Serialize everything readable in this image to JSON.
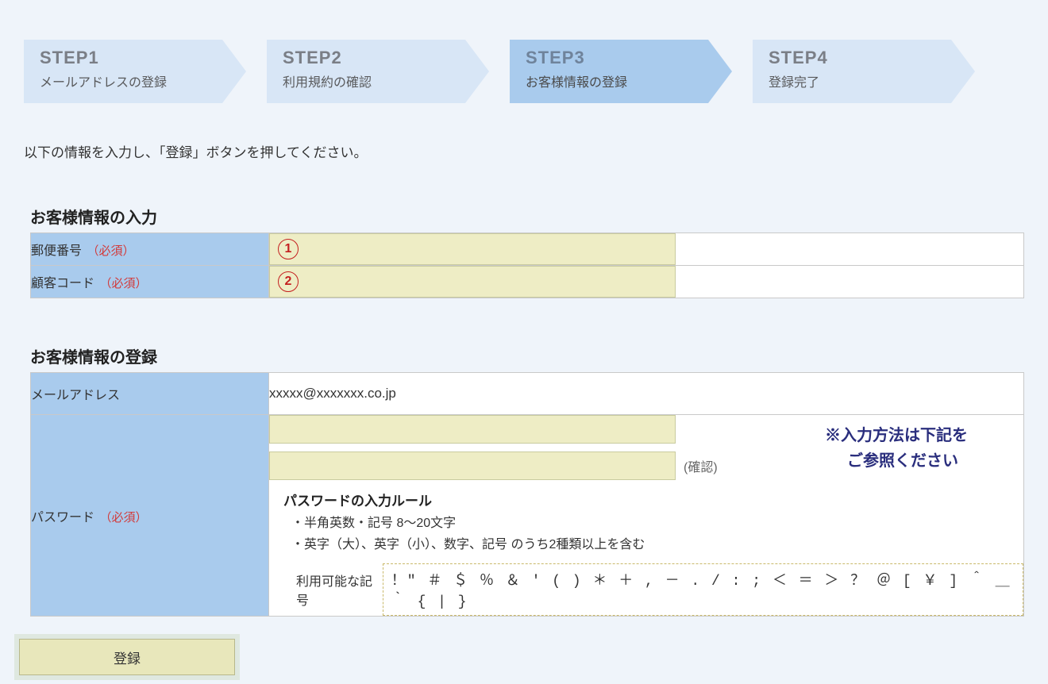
{
  "steps": [
    {
      "title": "STEP1",
      "sub": "メールアドレスの登録"
    },
    {
      "title": "STEP2",
      "sub": "利用規約の確認"
    },
    {
      "title": "STEP3",
      "sub": "お客様情報の登録"
    },
    {
      "title": "STEP4",
      "sub": "登録完了"
    }
  ],
  "activeStepIndex": 2,
  "colors": {
    "inactiveStep": "#d8e6f6",
    "activeStep": "#a9cbed",
    "headerCell": "#a9cbed",
    "inputBg": "#eeedc5",
    "required": "#d23a3a",
    "note": "#2a2e7d"
  },
  "intro": "以下の情報を入力し、「登録」ボタンを押してください。",
  "section1": {
    "title": "お客様情報の入力",
    "rows": [
      {
        "label": "郵便番号",
        "required": "（必須）",
        "marker": "1",
        "value": ""
      },
      {
        "label": "顧客コード",
        "required": "（必須）",
        "marker": "2",
        "value": ""
      }
    ]
  },
  "section2": {
    "title": "お客様情報の登録",
    "emailLabel": "メールアドレス",
    "emailValue": "xxxxx@xxxxxxx.co.jp",
    "passwordLabel": "パスワード",
    "passwordRequired": "（必須）",
    "confirmLabel": "(確認)",
    "note_line1": "※入力方法は下記を",
    "note_line2": "ご参照ください",
    "rulesTitle": "パスワードの入力ルール",
    "rule1": "・半角英数・記号 8～20文字",
    "rule2": "・英字（大）、英字（小）、数字、記号 のうち2種類以上を含む",
    "symbolsLabel": "利用可能な記号",
    "symbols": "！\" ＃ ＄ ％ ＆ ' ( ) ＊ ＋ , － . / : ; ＜ ＝ ＞ ？ ＠ [ ￥ ] ＾ ＿ ｀ { | }"
  },
  "submitLabel": "登録"
}
